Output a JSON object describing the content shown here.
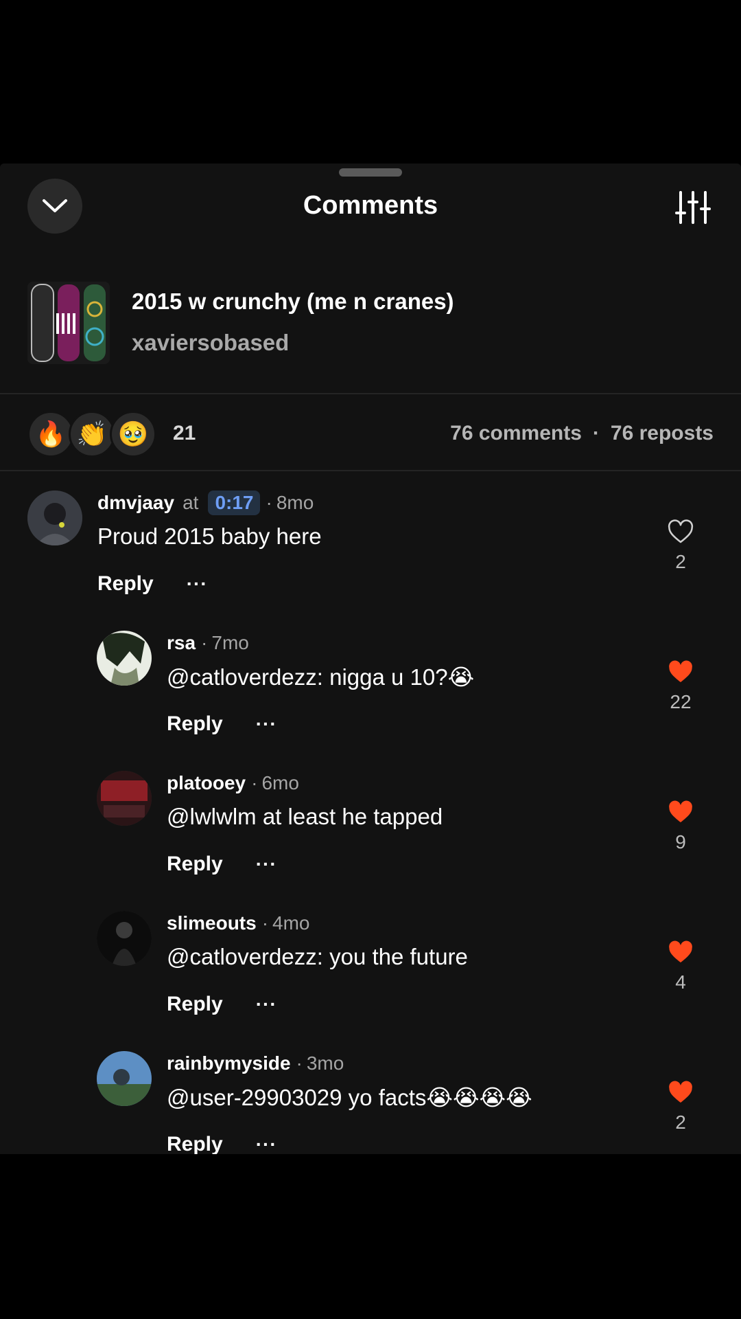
{
  "header": {
    "title": "Comments"
  },
  "track": {
    "title": "2015 w crunchy (me n cranes)",
    "artist": "xaviersobased"
  },
  "reactions": {
    "emojis": [
      "🔥",
      "👏",
      "🥹"
    ],
    "count": "21"
  },
  "counts": {
    "comments": "76 comments",
    "separator": "·",
    "reposts": "76 reposts"
  },
  "comments": [
    {
      "user": "dmvjaay",
      "at": "at",
      "timestamp": "0:17",
      "time": "8mo",
      "text": "Proud 2015 baby here",
      "likes": "2",
      "liked": false,
      "reply": "Reply",
      "more": "···"
    },
    {
      "user": "rsa",
      "time": "7mo",
      "text": "@catloverdezz: nigga u 10?😭",
      "likes": "22",
      "liked": true,
      "reply": "Reply",
      "more": "···"
    },
    {
      "user": "platooey",
      "time": "6mo",
      "text": "@lwlwlm at least he tapped",
      "likes": "9",
      "liked": true,
      "reply": "Reply",
      "more": "···"
    },
    {
      "user": "slimeouts",
      "time": "4mo",
      "text": "@catloverdezz: you the future",
      "likes": "4",
      "liked": true,
      "reply": "Reply",
      "more": "···"
    },
    {
      "user": "rainbymyside",
      "time": "3mo",
      "text": "@user-29903029 yo facts😭😭😭😭",
      "likes": "2",
      "liked": true,
      "reply": "Reply",
      "more": "···"
    }
  ],
  "colors": {
    "background": "#121212",
    "accent_like": "#ff4a1c",
    "timestamp_link": "#6e9ef5"
  }
}
